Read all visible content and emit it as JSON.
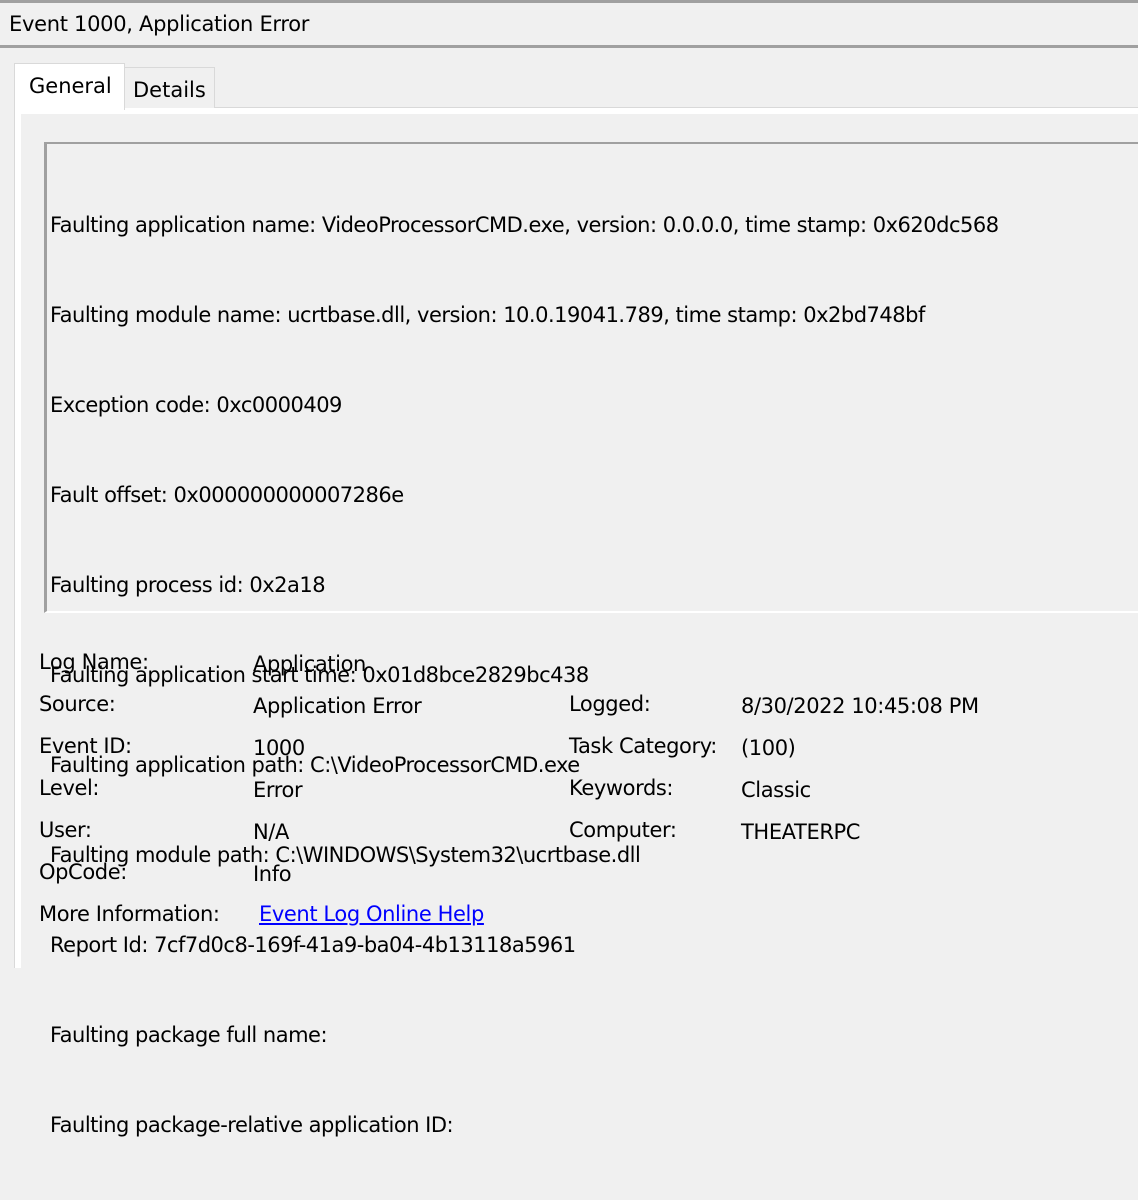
{
  "window": {
    "title": "Event 1000, Application Error"
  },
  "tabs": [
    {
      "label": "General",
      "selected": true
    },
    {
      "label": "Details",
      "selected": false
    }
  ],
  "description": {
    "lines": [
      "Faulting application name: VideoProcessorCMD.exe, version: 0.0.0.0, time stamp: 0x620dc568",
      "Faulting module name: ucrtbase.dll, version: 10.0.19041.789, time stamp: 0x2bd748bf",
      "Exception code: 0xc0000409",
      "Fault offset: 0x000000000007286e",
      "Faulting process id: 0x2a18",
      "Faulting application start time: 0x01d8bce2829bc438",
      "Faulting application path: C:\\VideoProcessorCMD.exe",
      "Faulting module path: C:\\WINDOWS\\System32\\ucrtbase.dll",
      "Report Id: 7cf7d0c8-169f-41a9-ba04-4b13118a5961",
      "Faulting package full name:",
      "Faulting package-relative application ID:"
    ]
  },
  "properties": {
    "log_name": {
      "label": "Log Name:",
      "value": "Application"
    },
    "source": {
      "label": "Source:",
      "value": "Application Error"
    },
    "logged": {
      "label": "Logged:",
      "value": "8/30/2022 10:45:08 PM"
    },
    "event_id": {
      "label": "Event ID:",
      "value": "1000"
    },
    "task_category": {
      "label": "Task Category:",
      "value": "(100)"
    },
    "level": {
      "label": "Level:",
      "value": "Error"
    },
    "keywords": {
      "label": "Keywords:",
      "value": "Classic"
    },
    "user": {
      "label": "User:",
      "value": "N/A"
    },
    "computer": {
      "label": "Computer:",
      "value": "THEATERPC"
    },
    "opcode": {
      "label": "OpCode:",
      "value": "Info"
    },
    "more_information": {
      "label": "More Information:",
      "link_text": "Event Log Online Help"
    }
  },
  "colors": {
    "link": "#0000ff",
    "background": "#f0f0f0",
    "border": "#a0a0a0"
  }
}
